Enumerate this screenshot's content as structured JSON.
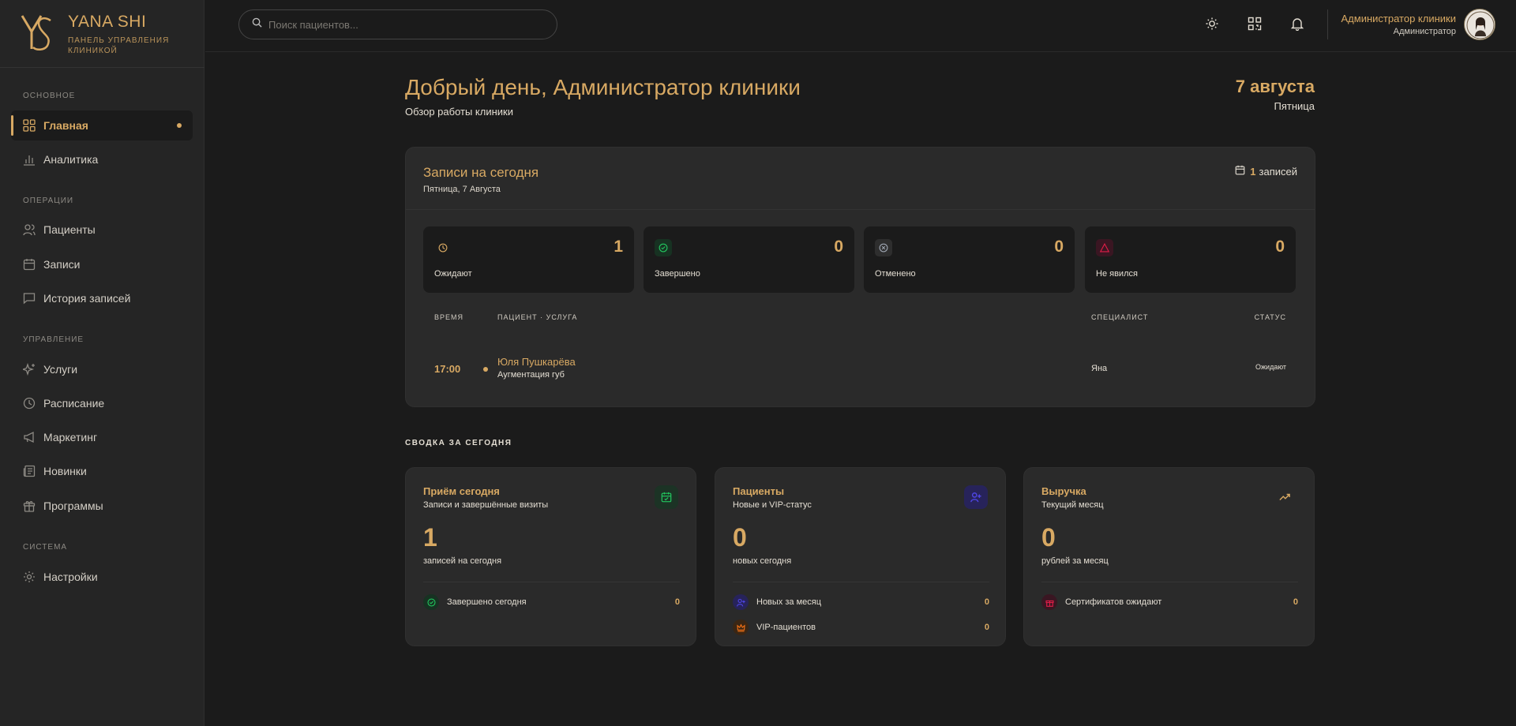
{
  "brand": {
    "title": "YANA SHI",
    "subtitle": "ПАНЕЛЬ УПРАВЛЕНИЯ КЛИНИКОЙ"
  },
  "sidebar": {
    "sections": [
      {
        "label": "ОСНОВНОЕ"
      },
      {
        "label": "ОПЕРАЦИИ"
      },
      {
        "label": "УПРАВЛЕНИЕ"
      },
      {
        "label": "СИСТЕМА"
      }
    ],
    "items": [
      {
        "label": "Главная",
        "icon": "grid-icon"
      },
      {
        "label": "Аналитика",
        "icon": "bar-chart-icon"
      },
      {
        "label": "Пациенты",
        "icon": "users-icon"
      },
      {
        "label": "Записи",
        "icon": "calendar-icon"
      },
      {
        "label": "История записей",
        "icon": "message-icon"
      },
      {
        "label": "Услуги",
        "icon": "sparkles-icon"
      },
      {
        "label": "Расписание",
        "icon": "clock-icon"
      },
      {
        "label": "Маркетинг",
        "icon": "megaphone-icon"
      },
      {
        "label": "Новинки",
        "icon": "newspaper-icon"
      },
      {
        "label": "Программы",
        "icon": "gift-icon"
      },
      {
        "label": "Настройки",
        "icon": "gear-icon"
      }
    ]
  },
  "search": {
    "placeholder": "Поиск пациентов..."
  },
  "user": {
    "name": "Администратор клиники",
    "role": "Администратор"
  },
  "header": {
    "greeting": "Добрый день, Администратор клиники",
    "subtitle": "Обзор работы клиники",
    "date": "7 августа",
    "weekday": "Пятница"
  },
  "appointments": {
    "title": "Записи на сегодня",
    "date": "Пятница, 7 Августа",
    "count": "1",
    "count_label": "записей",
    "stats": [
      {
        "label": "Ожидают",
        "value": "1",
        "icon": "clock-icon",
        "color": "#d8a963"
      },
      {
        "label": "Завершено",
        "value": "0",
        "icon": "check-circle-icon",
        "color": "#22c55e"
      },
      {
        "label": "Отменено",
        "value": "0",
        "icon": "x-circle-icon",
        "color": "#9ca3af"
      },
      {
        "label": "Не явился",
        "value": "0",
        "icon": "alert-triangle-icon",
        "color": "#e11d48"
      }
    ],
    "columns": [
      "ВРЕМЯ",
      "ПАЦИЕНТ · УСЛУГА",
      "СПЕЦИАЛИСТ",
      "СТАТУС"
    ],
    "rows": [
      {
        "time": "17:00",
        "patient": "Юля Пушкарёва",
        "service": "Аугментация губ",
        "specialist": "Яна",
        "status": "Ожидают"
      }
    ]
  },
  "summary": {
    "heading": "СВОДКА ЗА СЕГОДНЯ",
    "cards": [
      {
        "title": "Приём сегодня",
        "subtitle": "Записи и завершённые визиты",
        "value": "1",
        "value_label": "записей на сегодня",
        "icon": "calendar-check-icon",
        "accent": "#22c55e",
        "rows": [
          {
            "label": "Завершено сегодня",
            "value": "0",
            "icon": "check-circle-icon",
            "color": "#22c55e"
          }
        ]
      },
      {
        "title": "Пациенты",
        "subtitle": "Новые и VIP-статус",
        "value": "0",
        "value_label": "новых сегодня",
        "icon": "user-plus-icon",
        "accent": "#4f46e5",
        "rows": [
          {
            "label": "Новых за месяц",
            "value": "0",
            "icon": "user-plus-icon",
            "color": "#4f46e5"
          },
          {
            "label": "VIP-пациентов",
            "value": "0",
            "icon": "crown-icon",
            "color": "#f97316"
          }
        ]
      },
      {
        "title": "Выручка",
        "subtitle": "Текущий месяц",
        "value": "0",
        "value_label": "рублей за месяц",
        "icon": "trending-up-icon",
        "accent": "#d8a963",
        "rows": [
          {
            "label": "Сертификатов ожидают",
            "value": "0",
            "icon": "gift-icon",
            "color": "#e11d48"
          }
        ]
      }
    ]
  },
  "colors": {
    "accent": "#d8a963",
    "background": "#1b1b1b",
    "sidebar": "#252525",
    "card": "#2a2a2a"
  }
}
